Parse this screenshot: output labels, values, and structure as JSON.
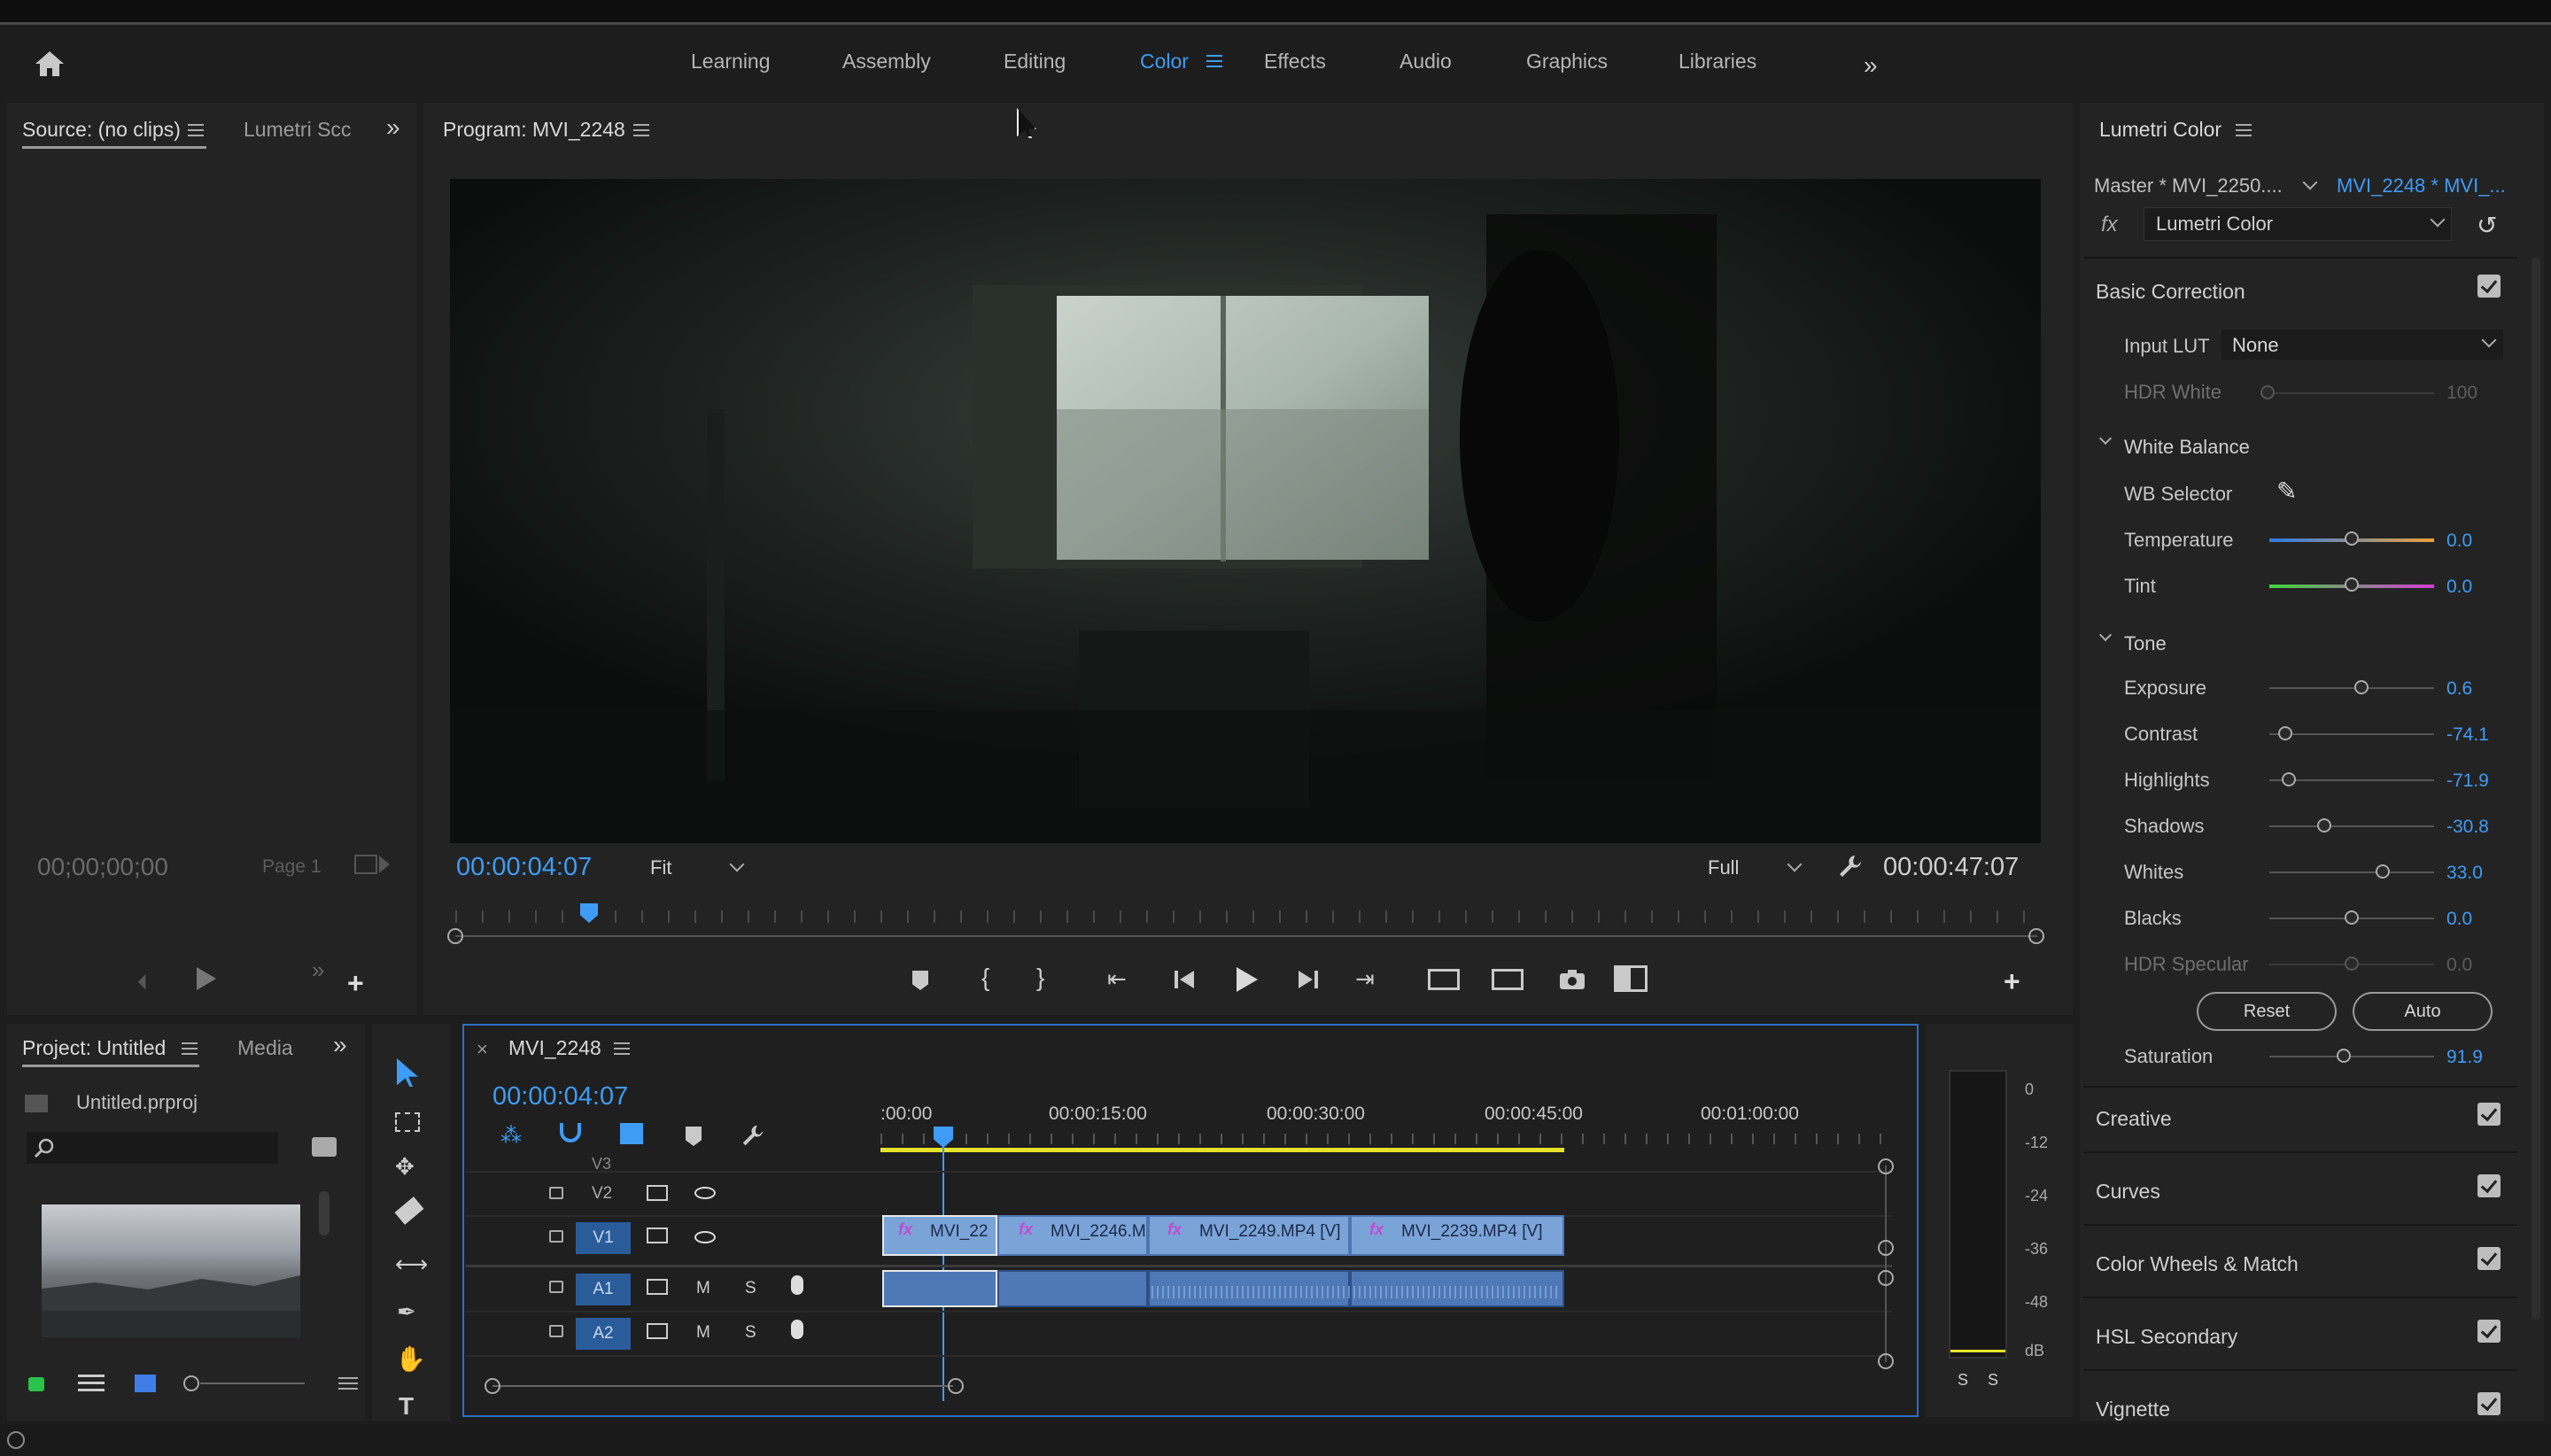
{
  "workspaces": [
    "Learning",
    "Assembly",
    "Editing",
    "Color",
    "Effects",
    "Audio",
    "Graphics",
    "Libraries"
  ],
  "active_workspace": "Color",
  "source_panel": {
    "tabs": [
      "Source: (no clips)",
      "Lumetri Scc"
    ],
    "timecode": "00;00;00;00",
    "page": "Page 1"
  },
  "program_panel": {
    "title": "Program: MVI_2248",
    "timecode": "00:00:04:07",
    "fit": "Fit",
    "quality": "Full",
    "duration": "00:00:47:07"
  },
  "project_panel": {
    "tabs": [
      "Project: Untitled",
      "Media"
    ],
    "file": "Untitled.prproj"
  },
  "timeline": {
    "sequence": "MVI_2248",
    "timecode": "00:00:04:07",
    "ruler": [
      ":00:00",
      "00:00:15:00",
      "00:00:30:00",
      "00:00:45:00",
      "00:01:00:00"
    ],
    "tracks_video": [
      "V3",
      "V2",
      "V1"
    ],
    "tracks_audio": [
      "A1",
      "A2"
    ],
    "audio_mute": "M",
    "audio_solo": "S",
    "clips": [
      "MVI_22",
      "MVI_2246.M",
      "MVI_2249.MP4 [V]",
      "MVI_2239.MP4 [V]"
    ],
    "meter_scale": [
      "0",
      "-12",
      "-24",
      "-36",
      "-48",
      "dB"
    ],
    "meter_solo": [
      "S",
      "S"
    ]
  },
  "lumetri": {
    "title": "Lumetri Color",
    "master": "Master * MVI_2250....",
    "clip": "MVI_2248 * MVI_...",
    "effect": "Lumetri Color",
    "basic_correction": "Basic Correction",
    "input_lut_label": "Input LUT",
    "input_lut_value": "None",
    "hdr_white_label": "HDR White",
    "hdr_white_value": "100",
    "white_balance": "White Balance",
    "wb_selector": "WB Selector",
    "temperature_label": "Temperature",
    "temperature_value": "0.0",
    "tint_label": "Tint",
    "tint_value": "0.0",
    "tone": "Tone",
    "exposure_label": "Exposure",
    "exposure_value": "0.6",
    "contrast_label": "Contrast",
    "contrast_value": "-74.1",
    "highlights_label": "Highlights",
    "highlights_value": "-71.9",
    "shadows_label": "Shadows",
    "shadows_value": "-30.8",
    "whites_label": "Whites",
    "whites_value": "33.0",
    "blacks_label": "Blacks",
    "blacks_value": "0.0",
    "hdr_specular_label": "HDR Specular",
    "hdr_specular_value": "0.0",
    "reset": "Reset",
    "auto": "Auto",
    "saturation_label": "Saturation",
    "saturation_value": "91.9",
    "sections": [
      "Creative",
      "Curves",
      "Color Wheels & Match",
      "HSL Secondary",
      "Vignette"
    ]
  },
  "colors": {
    "accent": "#3e9cf5",
    "panel": "#232323",
    "clip_video": "#7aa3d8",
    "clip_audio": "#4f78b6",
    "fx": "#c24ad2",
    "work_area": "#e6e22a"
  }
}
